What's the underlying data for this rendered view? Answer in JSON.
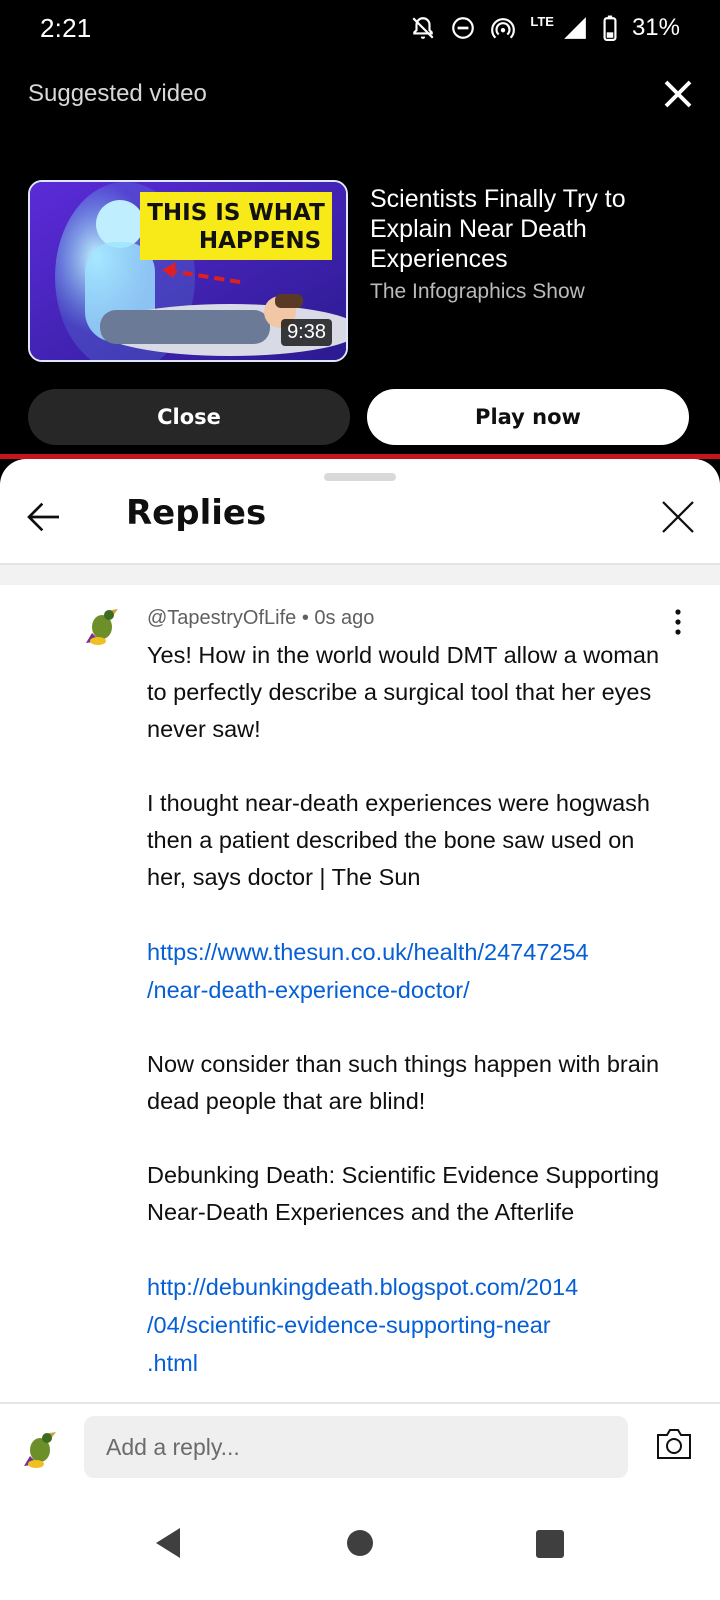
{
  "status_bar": {
    "time": "2:21",
    "network": "LTE",
    "battery": "31%",
    "icons": [
      "notifications-off-icon",
      "do-not-disturb-icon",
      "hotspot-icon",
      "signal-icon",
      "battery-icon"
    ]
  },
  "suggested": {
    "heading": "Suggested video",
    "video_title": "Scientists Finally Try to Explain Near Death Experiences",
    "channel": "The Infographics Show",
    "duration": "9:38",
    "thumbnail_text_line1": "THIS IS WHAT",
    "thumbnail_text_line2": "HAPPENS",
    "close_label": "Close",
    "play_label": "Play now"
  },
  "replies_panel": {
    "title": "Replies"
  },
  "comment": {
    "author": "@TapestryOfLife",
    "time_ago": "0s ago",
    "paragraph1": "Yes! How in the world would DMT allow a woman to perfectly describe a surgical tool that her eyes never saw!",
    "paragraph2": "I thought near-death experiences were hogwash then a patient described the bone saw used on her, says doctor | The Sun",
    "link1_line1": "https://www.thesun.co.uk/health/24747254",
    "link1_line2": "/near-death-experience-doctor/",
    "paragraph3": "Now consider than such things happen with brain dead people that are blind!",
    "paragraph4": "Debunking Death: Scientific Evidence Supporting Near-Death Experiences and the Afterlife",
    "link2_line1": "http://debunkingdeath.blogspot.com/2014",
    "link2_line2": "/04/scientific-evidence-supporting-near",
    "link2_line3": ".html"
  },
  "reply_bar": {
    "placeholder": "Add a reply..."
  },
  "colors": {
    "accent_red": "#c4161c",
    "link_blue": "#065fd4",
    "thumbnail_banner": "#f7ea18"
  }
}
